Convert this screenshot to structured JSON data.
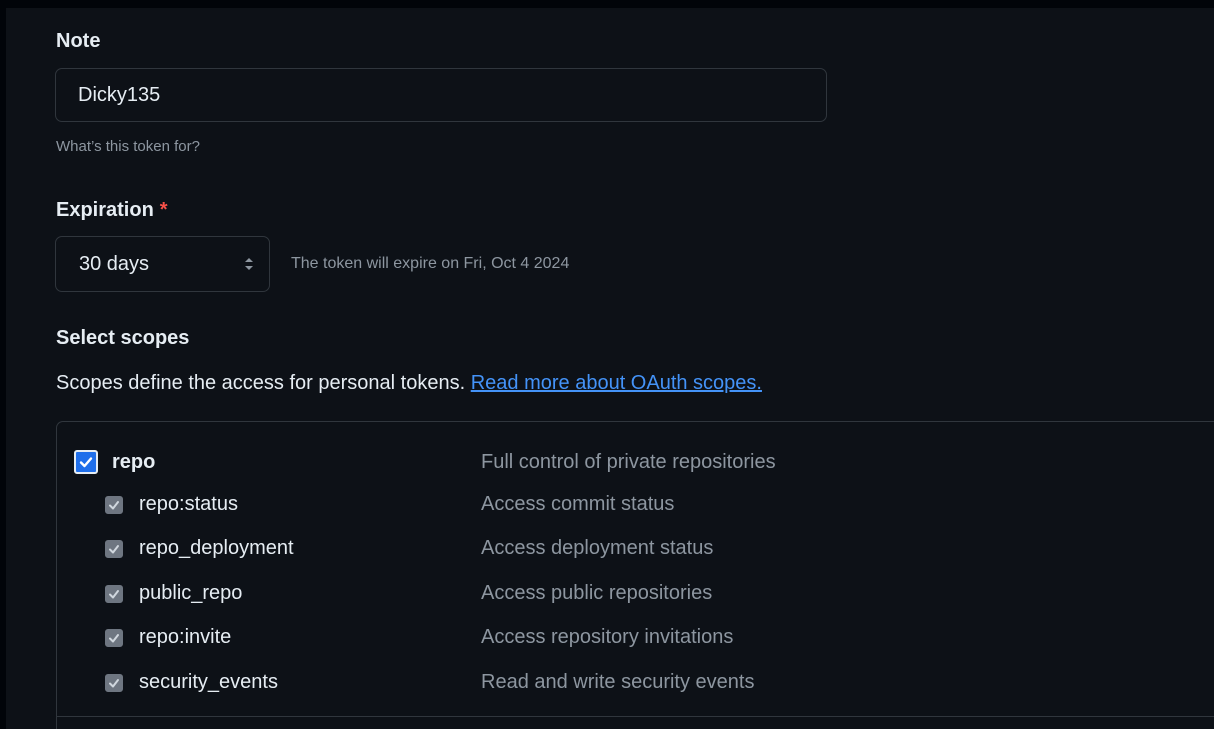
{
  "note": {
    "label": "Note",
    "value": "Dicky135",
    "help": "What’s this token for?"
  },
  "expiration": {
    "label": "Expiration",
    "required_mark": "*",
    "selected": "30 days",
    "note": "The token will expire on Fri, Oct 4 2024"
  },
  "scopes": {
    "label": "Select scopes",
    "description": "Scopes define the access for personal tokens.",
    "link_text": "Read more about OAuth scopes.",
    "primary": {
      "name": "repo",
      "description": "Full control of private repositories",
      "checked": true
    },
    "items": [
      {
        "name": "repo:status",
        "description": "Access commit status",
        "checked": true
      },
      {
        "name": "repo_deployment",
        "description": "Access deployment status",
        "checked": true
      },
      {
        "name": "public_repo",
        "description": "Access public repositories",
        "checked": true
      },
      {
        "name": "repo:invite",
        "description": "Access repository invitations",
        "checked": true
      },
      {
        "name": "security_events",
        "description": "Read and write security events",
        "checked": true
      }
    ]
  },
  "colors": {
    "background": "#0d1117",
    "border": "#30363d",
    "text": "#e6edf3",
    "muted": "#8d96a0",
    "link": "#4493f8",
    "required": "#f85149",
    "checkbox_accent": "#1f6feb"
  },
  "icons": {
    "select_arrows": "updown-chevron-icon",
    "checkmark": "checkmark-icon"
  }
}
